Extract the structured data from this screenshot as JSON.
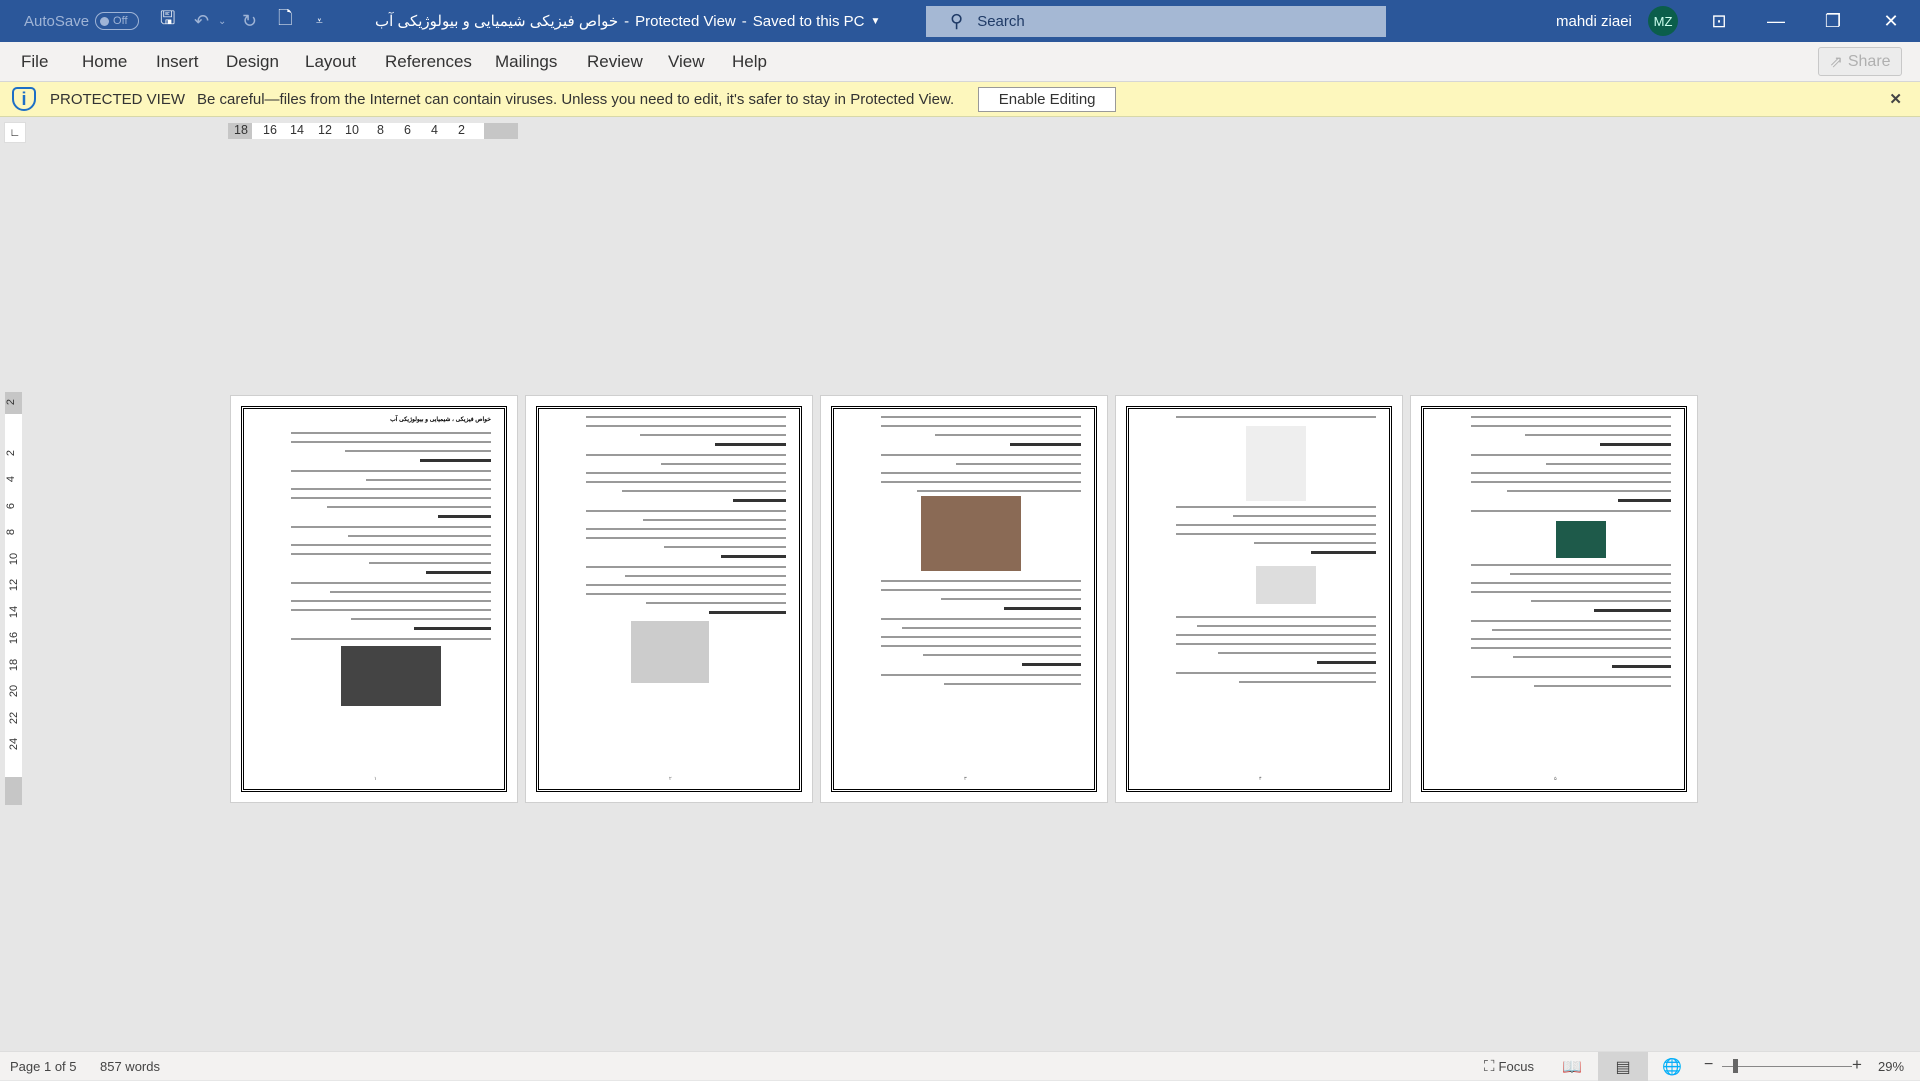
{
  "titlebar": {
    "autosave_label": "AutoSave",
    "autosave_state": "Off",
    "doc_title": "خواص فیزیکی شیمیایی و بیولوژیکی آب",
    "mode": "Protected View",
    "saved": "Saved to this PC",
    "search_placeholder": "Search",
    "user_name": "mahdi ziaei",
    "user_initials": "MZ"
  },
  "menu": {
    "tabs": [
      "File",
      "Home",
      "Insert",
      "Design",
      "Layout",
      "References",
      "Mailings",
      "Review",
      "View",
      "Help"
    ],
    "share": "Share"
  },
  "protected_view": {
    "label": "PROTECTED VIEW",
    "message": "Be careful—files from the Internet can contain viruses. Unless you need to edit, it's safer to stay in Protected View.",
    "button": "Enable Editing"
  },
  "ruler": {
    "horizontal": [
      "18",
      "16",
      "14",
      "12",
      "10",
      "8",
      "6",
      "4",
      "2"
    ],
    "vertical": [
      "2",
      "2",
      "4",
      "6",
      "8",
      "10",
      "12",
      "14",
      "16",
      "18",
      "20",
      "22",
      "24"
    ]
  },
  "pages": [
    {
      "heading": "خواص فیزیکی ، شیمیایی و بیولوژیکی آب",
      "number": "۱"
    },
    {
      "number": "۲"
    },
    {
      "number": "۳"
    },
    {
      "number": "۴"
    },
    {
      "number": "۵"
    }
  ],
  "status": {
    "page": "Page 1 of 5",
    "words": "857 words",
    "focus": "Focus",
    "zoom": "29%"
  },
  "colors": {
    "titlebar": "#2b579a",
    "protected_bar": "#fdf7bd",
    "avatar": "#0b5e4b"
  }
}
